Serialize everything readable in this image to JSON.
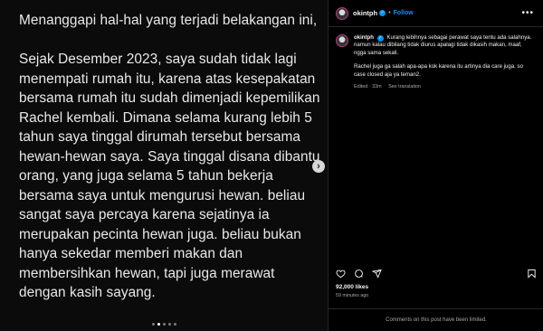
{
  "post": {
    "paragraphs": [
      "Menanggapi hal-hal yang terjadi belakangan ini,",
      "Sejak Desember 2023, saya sudah tidak lagi menempati rumah itu, karena atas kesepakatan bersama rumah itu sudah dimenjadi kepemilikan Rachel kembali. Dimana selama kurang lebih 5 tahun saya tinggal dirumah tersebut bersama hewan-hewan saya. Saya tinggal disana dibantu orang, yang juga selama 5 tahun bekerja bersama saya untuk mengurusi hewan. beliau sangat saya percaya karena sejatinya ia merupakan pecinta hewan juga. beliau bukan hanya sekedar memberi makan dan membersihkan hewan, tapi juga merawat dengan kasih sayang."
    ],
    "next_icon": "chevron-right-icon"
  },
  "header": {
    "username": "okintph",
    "separator": "•",
    "follow_label": "Follow",
    "more_icon": "more-horizontal-icon"
  },
  "caption": {
    "username": "okintph",
    "text1": "Kurang lebihnya sebagai perawat saya tentu ada salahnya. namun kalau dibilang tidak diurus apalagi tidak dikasih makan, maaf, ngga sama sekali.",
    "text2": "Rachel juga ga salah apa-apa kok karena itu artinya dia care juga. so case closed aja ya teman2.",
    "edited": "Edited · 33m",
    "see_translation": "See translation"
  },
  "stats": {
    "likes": "92,000 likes",
    "time": "59 minutes ago"
  },
  "footer": {
    "comments_limited": "Comments on this post have been limited."
  },
  "colors": {
    "accent": "#0095f6",
    "background": "#000000",
    "media_bg": "#0b0b0b"
  }
}
